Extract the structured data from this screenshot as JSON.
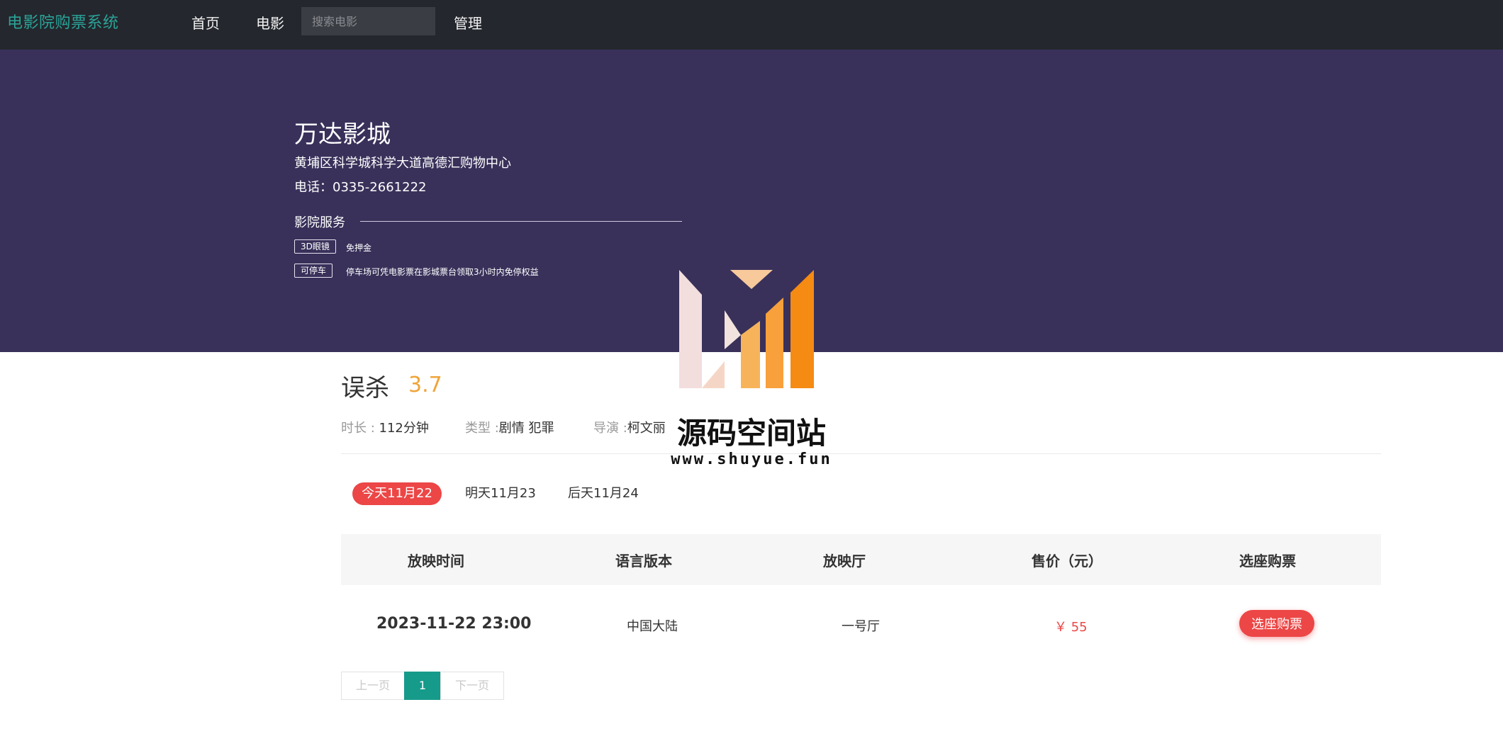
{
  "nav": {
    "brand": "电影院购票系统",
    "home": "首页",
    "movies": "电影",
    "search_placeholder": "搜索电影",
    "admin": "管理"
  },
  "cinema": {
    "name": "万达影城",
    "address": "黄埔区科学城科学大道高德汇购物中心",
    "phone": "电话：0335-2661222",
    "services_title": "影院服务",
    "services": [
      {
        "tag": "3D眼镜",
        "desc": "免押金"
      },
      {
        "tag": "可停车",
        "desc": "停车场可凭电影票在影城票台领取3小时内免停权益"
      }
    ]
  },
  "movie": {
    "title": "误杀",
    "score": "3.7",
    "duration_label": "时长 : ",
    "duration": "112分钟",
    "genre_label": "类型 :",
    "genre": "剧情 犯罪",
    "director_label": "导演 :",
    "director": "柯文丽"
  },
  "dates": [
    "今天11月22",
    "明天11月23",
    "后天11月24"
  ],
  "table": {
    "headers": [
      "放映时间",
      "语言版本",
      "放映厅",
      "售价（元）",
      "选座购票"
    ],
    "rows": [
      {
        "time": "2023-11-22 23:00",
        "language": "中国大陆",
        "hall": "一号厅",
        "price": "￥ 55",
        "action": "选座购票"
      }
    ]
  },
  "pager": {
    "prev": "上一页",
    "current": "1",
    "next": "下一页"
  },
  "watermark": {
    "title": "源码空间站",
    "url": "www.shuyue.fun"
  },
  "colors": {
    "accent": "#ec4646",
    "teal": "#169a8a",
    "banner": "#39315a",
    "nav": "#24272d",
    "score": "#f0a43a"
  }
}
